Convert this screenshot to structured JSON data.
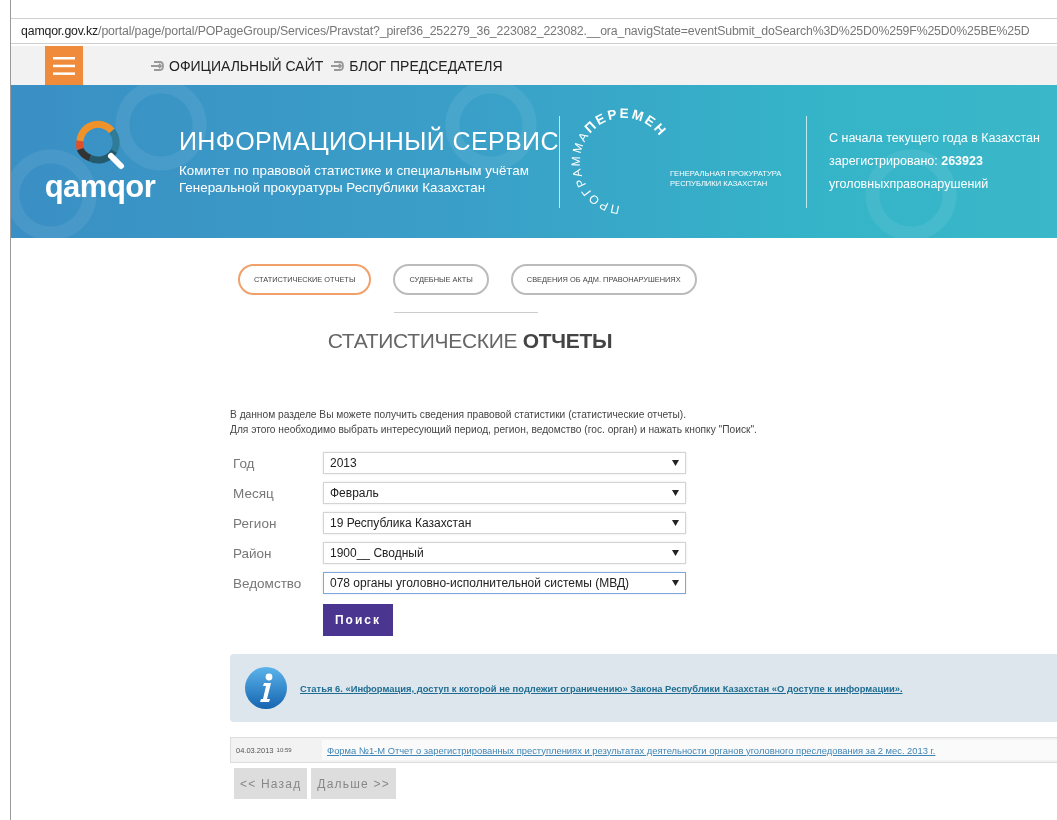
{
  "browser": {
    "url_host": "qamqor.gov.kz",
    "url_path": "/portal/page/portal/POPageGroup/Services/Pravstat?_piref36_252279_36_223082_223082.__ora_navigState=eventSubmit_doSearch%3D%25D0%259F%25D0%25BE%25D"
  },
  "nav": {
    "links": [
      {
        "label": "ОФИЦИАЛЬНЫЙ САЙТ"
      },
      {
        "label": "БЛОГ ПРЕДСЕДАТЕЛЯ"
      }
    ]
  },
  "banner": {
    "logo_word": "qamqor",
    "title": "ИНФОРМАЦИОННЫЙ СЕРВИС",
    "subtitle_lines": [
      "Комитет по правовой статистике и специальным учётам",
      "Генеральной прокуратуры Республики Казахстан"
    ],
    "program": {
      "arc_start": "ПРОГРАММА",
      "arc_end": "ПЕРЕМЕН",
      "caption_lines": [
        "ГЕНЕРАЛЬНАЯ ПРОКУРАТУРА",
        "РЕСПУБЛИКИ КАЗАХСТАН"
      ]
    },
    "counter_lines": [
      "С начала текущего года в Казахстан",
      "зарегистрировано: **263923**",
      "уголовныхправонарушений"
    ]
  },
  "tabs": [
    {
      "label": "СТАТИСТИЧЕСКИЕ ОТЧЕТЫ",
      "selected": true
    },
    {
      "label": "СУДЕБНЫЕ АКТЫ",
      "selected": false
    },
    {
      "label": "СВЕДЕНИЯ ОБ АДМ. ПРАВОНАРУШЕНИЯХ",
      "selected": false
    }
  ],
  "heading": "СТАТИСТИЧЕСКИЕ **ОТЧЕТЫ**",
  "intro_lines": [
    "В данном разделе Вы можете получить сведения правовой статистики (статистические отчеты).",
    "Для этого необходимо выбрать интересующий период, регион, ведомство (гос. орган) и нажать кнопку \"Поиск\"."
  ],
  "form": {
    "fields": [
      {
        "label": "Год",
        "value": "2013",
        "focused": false
      },
      {
        "label": "Месяц",
        "value": "Февраль",
        "focused": false
      },
      {
        "label": "Регион",
        "value": "19 Республика Казахстан",
        "focused": false
      },
      {
        "label": "Район",
        "value": "1900__ Сводный",
        "focused": false
      },
      {
        "label": "Ведомство",
        "value": "078 органы уголовно-исполнительной системы (МВД)",
        "focused": true
      }
    ],
    "submit": "Поиск"
  },
  "info": {
    "link": "Статья 6. «Информация, доступ к которой не подлежит ограничению» Закона Республики Казахстан «О доступе к информации»."
  },
  "reports": [
    {
      "date": "04.03.2013 $^{10:59}$",
      "title": "Форма №1-М Отчет о зарегистрированных преступлениях и результатах деятельности органов уголовного преследования за 2 мес. 2013 г."
    }
  ],
  "pager": [
    {
      "label": "<< Назад",
      "disabled": true
    },
    {
      "label": "Дальше >>",
      "disabled": true
    }
  ]
}
